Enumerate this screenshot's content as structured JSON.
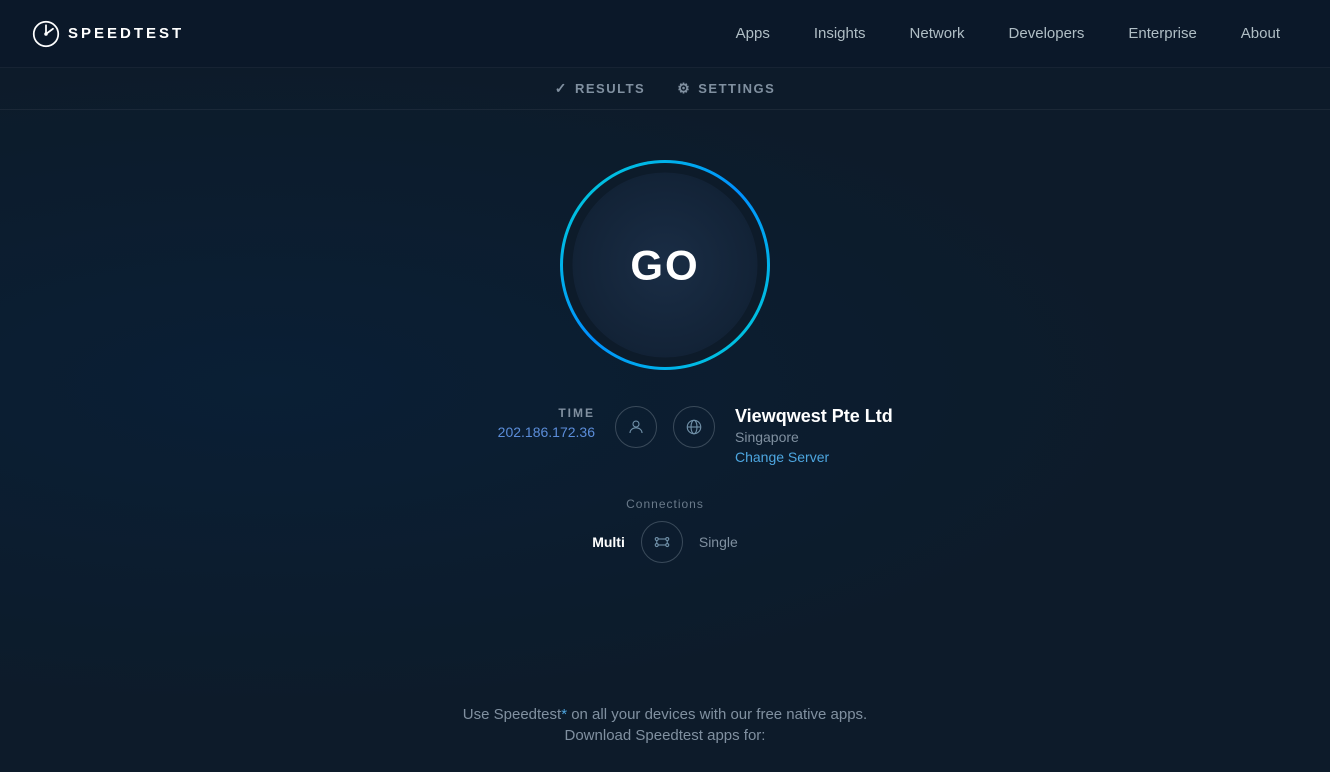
{
  "nav": {
    "logo_text": "SPEEDTEST",
    "links": [
      {
        "label": "Apps",
        "id": "apps"
      },
      {
        "label": "Insights",
        "id": "insights"
      },
      {
        "label": "Network",
        "id": "network"
      },
      {
        "label": "Developers",
        "id": "developers"
      },
      {
        "label": "Enterprise",
        "id": "enterprise"
      },
      {
        "label": "About",
        "id": "about"
      }
    ]
  },
  "sub_nav": {
    "results_label": "RESULTS",
    "settings_label": "SETTINGS"
  },
  "main": {
    "go_label": "GO",
    "info": {
      "time_label": "TIME",
      "ip_address": "202.186.172.36",
      "isp_name": "Viewqwest Pte Ltd",
      "isp_location": "Singapore",
      "change_server_label": "Change Server"
    },
    "connections": {
      "label": "Connections",
      "multi_label": "Multi",
      "single_label": "Single"
    }
  },
  "footer": {
    "line1": "Use Speedtest",
    "asterisk": "*",
    "line1_end": " on all your devices with our free native apps.",
    "line2": "Download Speedtest apps for:"
  }
}
